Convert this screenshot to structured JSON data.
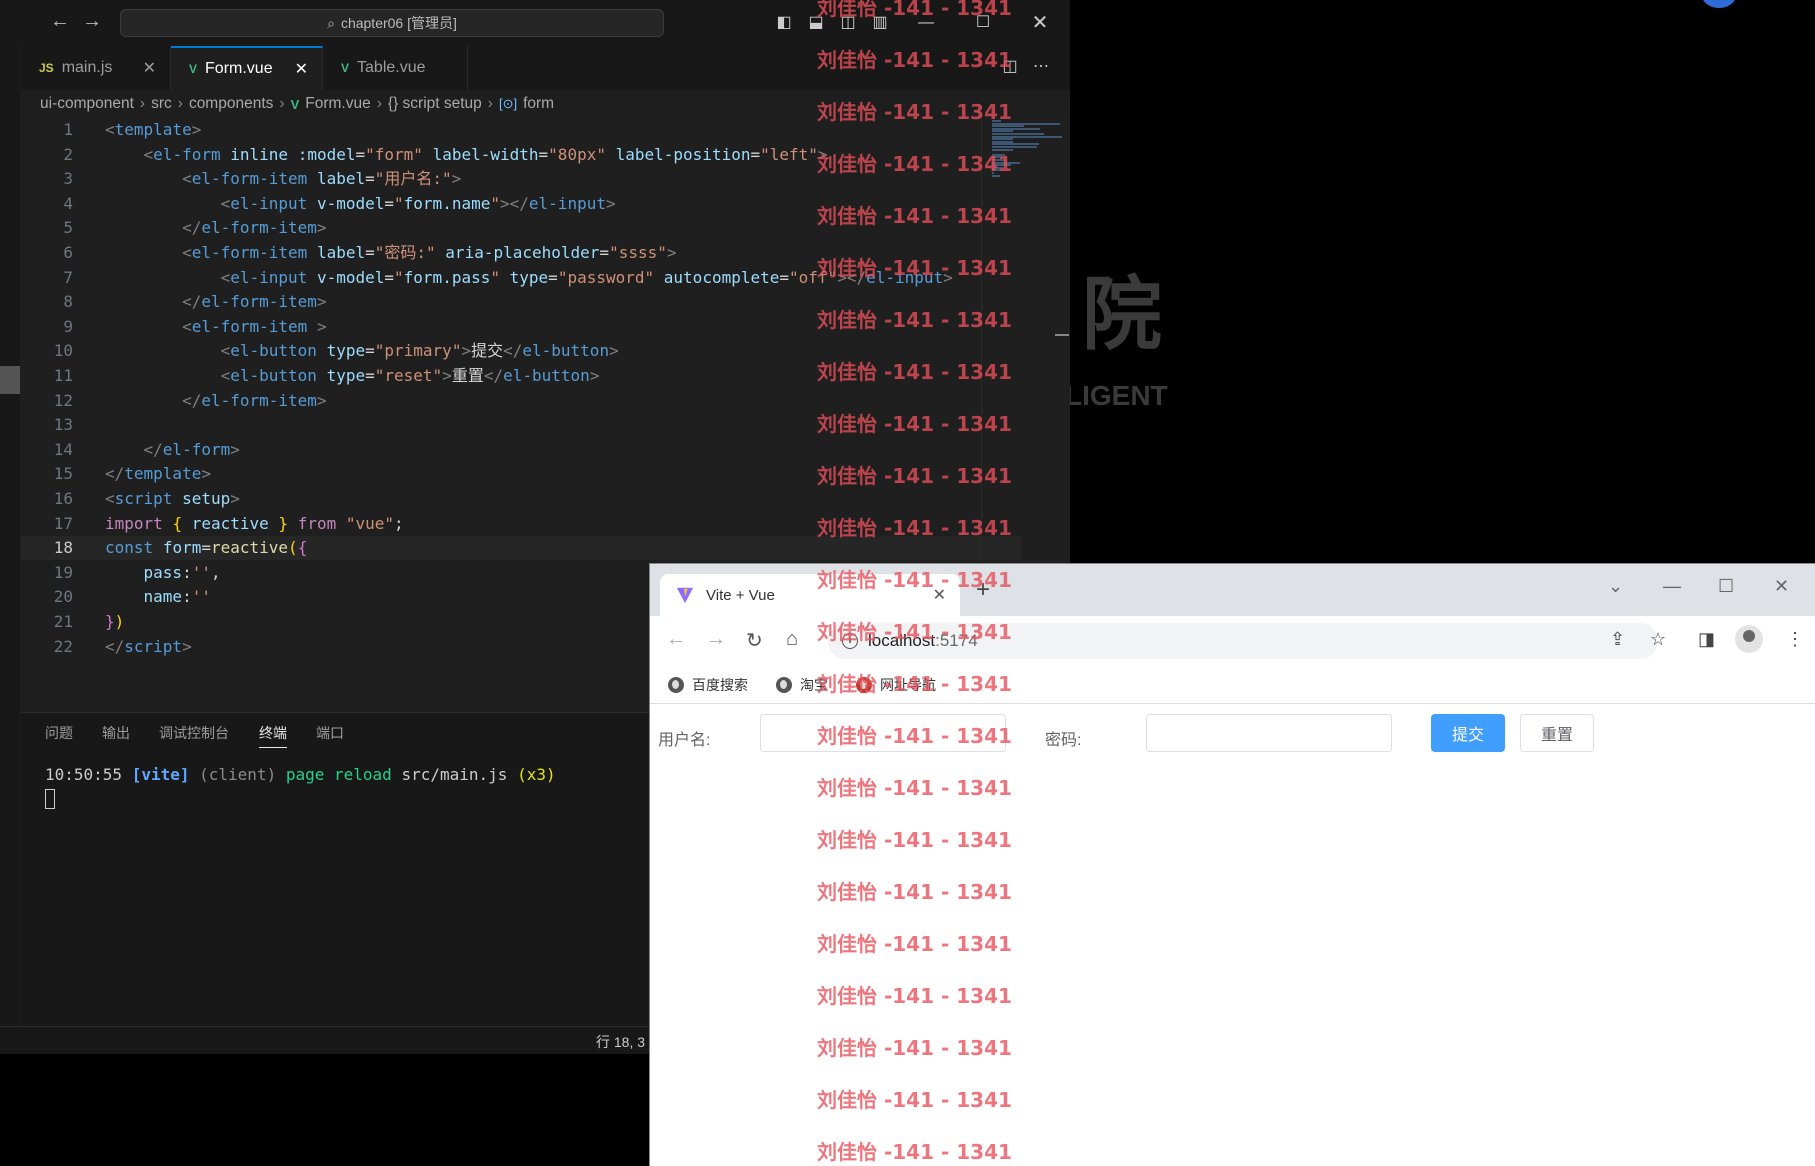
{
  "vscode": {
    "title": "chapter06 [管理员]",
    "tabs": [
      {
        "icon": "JS",
        "label": "main.js"
      },
      {
        "icon": "V",
        "label": "Form.vue"
      },
      {
        "icon": "V",
        "label": "Table.vue"
      }
    ],
    "breadcrumb": [
      "ui-component",
      "src",
      "components",
      "Form.vue",
      "{} script setup",
      "form"
    ],
    "code_lines": [
      [
        [
          "t-br",
          "<"
        ],
        [
          "t-tag",
          "template"
        ],
        [
          "t-br",
          ">"
        ]
      ],
      [
        [
          "t-txt",
          "    "
        ],
        [
          "t-br",
          "<"
        ],
        [
          "t-tag",
          "el-form"
        ],
        [
          "t-txt",
          " "
        ],
        [
          "t-attr",
          "inline"
        ],
        [
          "t-txt",
          " "
        ],
        [
          "t-attr",
          ":model"
        ],
        [
          "t-txt",
          "="
        ],
        [
          "t-str",
          "\"form\""
        ],
        [
          "t-txt",
          " "
        ],
        [
          "t-attr",
          "label-width"
        ],
        [
          "t-txt",
          "="
        ],
        [
          "t-str",
          "\"80px\""
        ],
        [
          "t-txt",
          " "
        ],
        [
          "t-attr",
          "label-position"
        ],
        [
          "t-txt",
          "="
        ],
        [
          "t-str",
          "\"left\""
        ],
        [
          "t-br",
          ">"
        ]
      ],
      [
        [
          "t-txt",
          "        "
        ],
        [
          "t-br",
          "<"
        ],
        [
          "t-tag",
          "el-form-item"
        ],
        [
          "t-txt",
          " "
        ],
        [
          "t-attr",
          "label"
        ],
        [
          "t-txt",
          "="
        ],
        [
          "t-str",
          "\"用户名:\""
        ],
        [
          "t-br",
          ">"
        ]
      ],
      [
        [
          "t-txt",
          "            "
        ],
        [
          "t-br",
          "<"
        ],
        [
          "t-tag",
          "el-input"
        ],
        [
          "t-txt",
          " "
        ],
        [
          "t-attr",
          "v-model"
        ],
        [
          "t-txt",
          "="
        ],
        [
          "t-str",
          "\""
        ],
        [
          "t-attr",
          "form.name"
        ],
        [
          "t-str",
          "\""
        ],
        [
          "t-br",
          "></"
        ],
        [
          "t-tag",
          "el-input"
        ],
        [
          "t-br",
          ">"
        ]
      ],
      [
        [
          "t-txt",
          "        "
        ],
        [
          "t-br",
          "</"
        ],
        [
          "t-tag",
          "el-form-item"
        ],
        [
          "t-br",
          ">"
        ]
      ],
      [
        [
          "t-txt",
          "        "
        ],
        [
          "t-br",
          "<"
        ],
        [
          "t-tag",
          "el-form-item"
        ],
        [
          "t-txt",
          " "
        ],
        [
          "t-attr",
          "label"
        ],
        [
          "t-txt",
          "="
        ],
        [
          "t-str",
          "\"密码:\""
        ],
        [
          "t-txt",
          " "
        ],
        [
          "t-attr",
          "aria-placeholder"
        ],
        [
          "t-txt",
          "="
        ],
        [
          "t-str",
          "\"ssss\""
        ],
        [
          "t-br",
          ">"
        ]
      ],
      [
        [
          "t-txt",
          "            "
        ],
        [
          "t-br",
          "<"
        ],
        [
          "t-tag",
          "el-input"
        ],
        [
          "t-txt",
          " "
        ],
        [
          "t-attr",
          "v-model"
        ],
        [
          "t-txt",
          "="
        ],
        [
          "t-str",
          "\""
        ],
        [
          "t-attr",
          "form.pass"
        ],
        [
          "t-str",
          "\""
        ],
        [
          "t-txt",
          " "
        ],
        [
          "t-attr",
          "type"
        ],
        [
          "t-txt",
          "="
        ],
        [
          "t-str",
          "\"password\""
        ],
        [
          "t-txt",
          " "
        ],
        [
          "t-attr",
          "autocomplete"
        ],
        [
          "t-txt",
          "="
        ],
        [
          "t-str",
          "\"off\""
        ],
        [
          "t-br",
          "></"
        ],
        [
          "t-tag",
          "el-input"
        ],
        [
          "t-br",
          ">"
        ]
      ],
      [
        [
          "t-txt",
          "        "
        ],
        [
          "t-br",
          "</"
        ],
        [
          "t-tag",
          "el-form-item"
        ],
        [
          "t-br",
          ">"
        ]
      ],
      [
        [
          "t-txt",
          "        "
        ],
        [
          "t-br",
          "<"
        ],
        [
          "t-tag",
          "el-form-item"
        ],
        [
          "t-txt",
          " "
        ],
        [
          "t-br",
          ">"
        ]
      ],
      [
        [
          "t-txt",
          "            "
        ],
        [
          "t-br",
          "<"
        ],
        [
          "t-tag",
          "el-button"
        ],
        [
          "t-txt",
          " "
        ],
        [
          "t-attr",
          "type"
        ],
        [
          "t-txt",
          "="
        ],
        [
          "t-str",
          "\"primary\""
        ],
        [
          "t-br",
          ">"
        ],
        [
          "t-txt",
          "提交"
        ],
        [
          "t-br",
          "</"
        ],
        [
          "t-tag",
          "el-button"
        ],
        [
          "t-br",
          ">"
        ]
      ],
      [
        [
          "t-txt",
          "            "
        ],
        [
          "t-br",
          "<"
        ],
        [
          "t-tag",
          "el-button"
        ],
        [
          "t-txt",
          " "
        ],
        [
          "t-attr",
          "type"
        ],
        [
          "t-txt",
          "="
        ],
        [
          "t-str",
          "\"reset\""
        ],
        [
          "t-br",
          ">"
        ],
        [
          "t-txt",
          "重置"
        ],
        [
          "t-br",
          "</"
        ],
        [
          "t-tag",
          "el-button"
        ],
        [
          "t-br",
          ">"
        ]
      ],
      [
        [
          "t-txt",
          "        "
        ],
        [
          "t-br",
          "</"
        ],
        [
          "t-tag",
          "el-form-item"
        ],
        [
          "t-br",
          ">"
        ]
      ],
      [
        [
          "t-txt",
          ""
        ]
      ],
      [
        [
          "t-txt",
          "    "
        ],
        [
          "t-br",
          "</"
        ],
        [
          "t-tag",
          "el-form"
        ],
        [
          "t-br",
          ">"
        ]
      ],
      [
        [
          "t-br",
          "</"
        ],
        [
          "t-tag",
          "template"
        ],
        [
          "t-br",
          ">"
        ]
      ],
      [
        [
          "t-br",
          "<"
        ],
        [
          "t-tag",
          "script"
        ],
        [
          "t-txt",
          " "
        ],
        [
          "t-attr",
          "setup"
        ],
        [
          "t-br",
          ">"
        ]
      ],
      [
        [
          "t-kw",
          "import"
        ],
        [
          "t-txt",
          " "
        ],
        [
          "t-p1",
          "{"
        ],
        [
          "t-txt",
          " "
        ],
        [
          "t-attr",
          "reactive"
        ],
        [
          "t-txt",
          " "
        ],
        [
          "t-p1",
          "}"
        ],
        [
          "t-txt",
          " "
        ],
        [
          "t-kw",
          "from"
        ],
        [
          "t-txt",
          " "
        ],
        [
          "t-str",
          "\"vue\""
        ],
        [
          "t-txt",
          ";"
        ]
      ],
      [
        [
          "t-kw2",
          "const"
        ],
        [
          "t-txt",
          " "
        ],
        [
          "t-attr",
          "form"
        ],
        [
          "t-txt",
          "="
        ],
        [
          "t-fn",
          "reactive"
        ],
        [
          "t-p1",
          "("
        ],
        [
          "t-p2",
          "{"
        ]
      ],
      [
        [
          "t-txt",
          "    "
        ],
        [
          "t-attr",
          "pass"
        ],
        [
          "t-txt",
          ":"
        ],
        [
          "t-str",
          "''"
        ],
        [
          "t-txt",
          ","
        ]
      ],
      [
        [
          "t-txt",
          "    "
        ],
        [
          "t-attr",
          "name"
        ],
        [
          "t-txt",
          ":"
        ],
        [
          "t-str",
          "''"
        ]
      ],
      [
        [
          "t-p2",
          "}"
        ],
        [
          "t-p1",
          ")"
        ]
      ],
      [
        [
          "t-br",
          "</"
        ],
        [
          "t-tag",
          "script"
        ],
        [
          "t-br",
          ">"
        ]
      ]
    ],
    "current_line": 18,
    "panel_tabs": [
      "问题",
      "输出",
      "调试控制台",
      "终端",
      "端口"
    ],
    "terminal": {
      "time": "10:50:55",
      "tag": "[vite]",
      "client": "(client)",
      "action": "page reload",
      "file": "src/main.js",
      "count": "(x3)"
    },
    "status": "行 18, 3"
  },
  "background": {
    "logo_char": "院",
    "logo_text": "LIGENT"
  },
  "browser": {
    "tab_title": "Vite + Vue",
    "url_host": "localhost",
    "url_port": ":5174",
    "bookmarks": [
      "百度搜索",
      "淘宝",
      "网址导航"
    ],
    "form": {
      "username_label": "用户名:",
      "password_label": "密码:",
      "submit_label": "提交",
      "reset_label": "重置"
    }
  },
  "watermark": {
    "text": "刘佳怡 -141 - 1341",
    "color": "#e8505b"
  },
  "colors": {
    "accent": "#0078d4",
    "primary_button": "#409eff",
    "editor_bg": "#1f1f1f"
  }
}
